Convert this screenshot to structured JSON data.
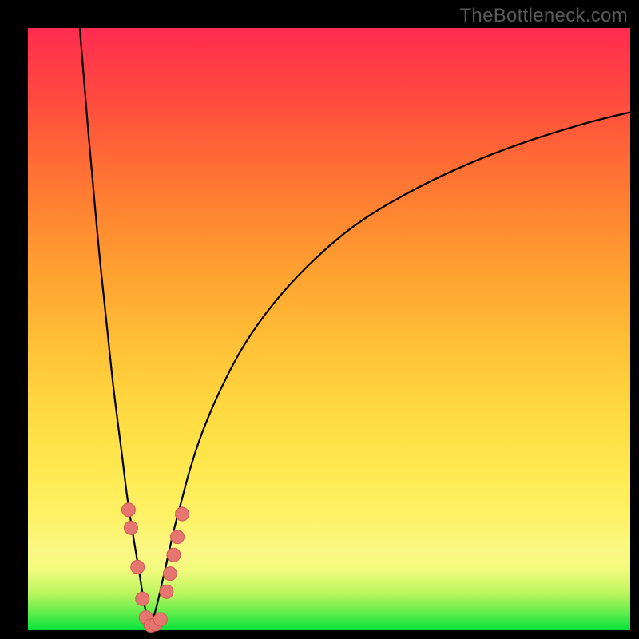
{
  "watermark": "TheBottleneck.com",
  "colors": {
    "frame": "#000000",
    "curve": "#000000",
    "marker_fill": "#e6766f",
    "marker_stroke": "#cf5a55",
    "gradient_top": "#ff2c50",
    "gradient_bottom": "#07e33a"
  },
  "chart_data": {
    "type": "line",
    "title": "",
    "xlabel": "",
    "ylabel": "",
    "xlim": [
      0,
      100
    ],
    "ylim": [
      0,
      100
    ],
    "grid": false,
    "legend": null,
    "description": "V-shaped bottleneck curve: sharp minimum near x≈20, steep rise on both sides, right branch asymptotically approaching the top.",
    "series": [
      {
        "name": "left_branch",
        "x": [
          8.6,
          10,
          12,
          14,
          15.5,
          16.5,
          17.5,
          18.5,
          19.2,
          19.8,
          20.2
        ],
        "y": [
          100,
          83,
          61,
          42,
          30,
          22,
          15.5,
          9.5,
          5,
          2,
          0.5
        ]
      },
      {
        "name": "right_branch",
        "x": [
          20.2,
          20.8,
          21.5,
          22.3,
          23.2,
          24.2,
          25.5,
          27,
          29,
          32,
          36,
          41,
          47,
          54,
          62,
          71,
          81,
          92,
          100
        ],
        "y": [
          0.5,
          2,
          4.5,
          8,
          12,
          16.5,
          21.5,
          27,
          33,
          40,
          47.5,
          54.5,
          61,
          67,
          72,
          76.5,
          80.5,
          84,
          86
        ]
      }
    ],
    "markers": [
      {
        "x": 16.7,
        "y": 20
      },
      {
        "x": 17.1,
        "y": 17
      },
      {
        "x": 18.2,
        "y": 10.5
      },
      {
        "x": 19.0,
        "y": 5.2
      },
      {
        "x": 19.6,
        "y": 2.1
      },
      {
        "x": 20.4,
        "y": 0.8
      },
      {
        "x": 21.2,
        "y": 1.0
      },
      {
        "x": 22.0,
        "y": 1.8
      },
      {
        "x": 23.0,
        "y": 6.4
      },
      {
        "x": 23.6,
        "y": 9.4
      },
      {
        "x": 24.2,
        "y": 12.5
      },
      {
        "x": 24.8,
        "y": 15.5
      },
      {
        "x": 25.6,
        "y": 19.3
      }
    ]
  }
}
